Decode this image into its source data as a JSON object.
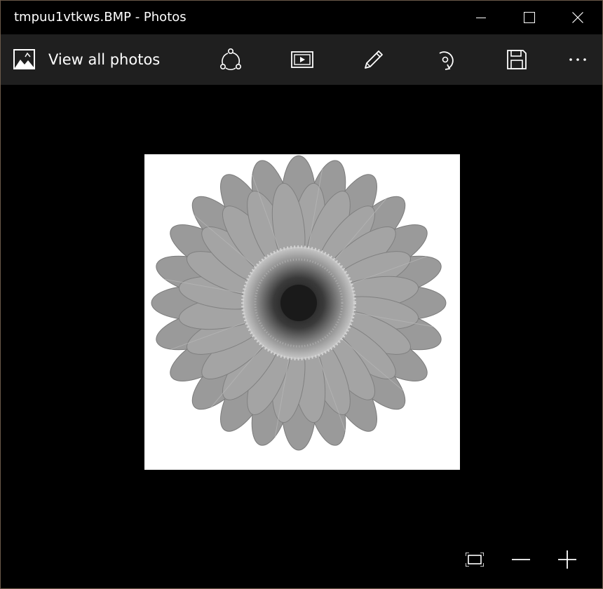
{
  "window": {
    "title": "tmpuu1vtkws.BMP - Photos"
  },
  "titlebar_buttons": {
    "minimize_icon": "minimize-icon",
    "maximize_icon": "maximize-icon",
    "close_icon": "close-icon"
  },
  "toolbar": {
    "view_all_label": "View all photos",
    "view_all_icon": "photos-icon",
    "buttons": [
      {
        "icon": "share-icon"
      },
      {
        "icon": "slideshow-icon"
      },
      {
        "icon": "edit-pencil-icon"
      },
      {
        "icon": "rotate-icon"
      },
      {
        "icon": "save-icon"
      },
      {
        "icon": "more-icon"
      }
    ]
  },
  "viewer": {
    "image_subject": "daisy-flower-grayscale",
    "zoom_controls": [
      {
        "icon": "fit-to-window-icon"
      },
      {
        "icon": "zoom-out-icon"
      },
      {
        "icon": "zoom-in-icon"
      }
    ]
  },
  "colors": {
    "background": "#000000",
    "toolbar": "#1f1f1f",
    "foreground": "#ffffff",
    "border": "#6b5a4a"
  }
}
